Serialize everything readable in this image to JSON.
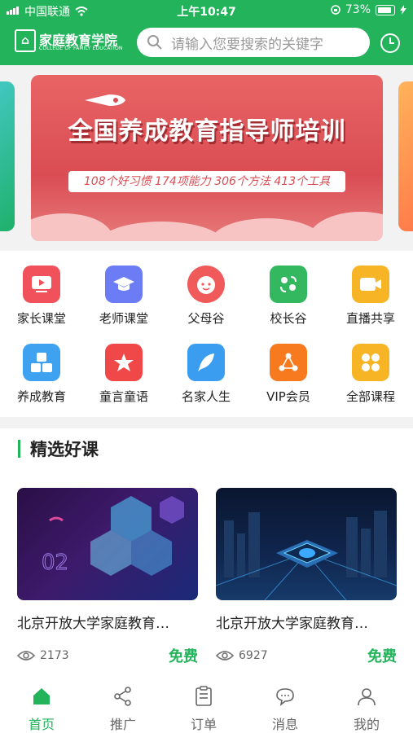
{
  "status_bar": {
    "carrier": "中国联通",
    "time": "上午10:47",
    "battery": "73%"
  },
  "header": {
    "logo_title": "家庭教育学院",
    "logo_subtitle": "COLLEGE OF FAMILY EDUCATION",
    "search_placeholder": "请输入您要搜索的关键字"
  },
  "banner": {
    "title": "全国养成教育指导师培训",
    "subtitle": "108个好习惯 174项能力 306个方法 413个工具"
  },
  "categories": [
    {
      "label": "家长课堂",
      "icon": "video-play-icon",
      "color": "#f0515a"
    },
    {
      "label": "老师课堂",
      "icon": "graduation-cap-icon",
      "color": "#6b7cf4"
    },
    {
      "label": "父母谷",
      "icon": "baby-face-icon",
      "color": "#f05a5a"
    },
    {
      "label": "校长谷",
      "icon": "people-exchange-icon",
      "color": "#33b860"
    },
    {
      "label": "直播共享",
      "icon": "camera-icon",
      "color": "#f7b425"
    },
    {
      "label": "养成教育",
      "icon": "number-blocks-icon",
      "color": "#3ea2f0"
    },
    {
      "label": "童言童语",
      "icon": "star-badge-icon",
      "color": "#f04848"
    },
    {
      "label": "名家人生",
      "icon": "feather-pen-icon",
      "color": "#3a9df0"
    },
    {
      "label": "VIP会员",
      "icon": "vip-network-icon",
      "color": "#f87a1f"
    },
    {
      "label": "全部课程",
      "icon": "grid-icon",
      "color": "#f7b425"
    }
  ],
  "section": {
    "title": "精选好课"
  },
  "courses": [
    {
      "name": "北京开放大学家庭教育…",
      "views": "2173",
      "price": "免费"
    },
    {
      "name": "北京开放大学家庭教育…",
      "views": "6927",
      "price": "免费"
    }
  ],
  "tabbar": [
    {
      "label": "首页",
      "icon": "home-icon",
      "active": true
    },
    {
      "label": "推广",
      "icon": "share-icon",
      "active": false
    },
    {
      "label": "订单",
      "icon": "order-icon",
      "active": false
    },
    {
      "label": "消息",
      "icon": "message-icon",
      "active": false
    },
    {
      "label": "我的",
      "icon": "user-icon",
      "active": false
    }
  ],
  "colors": {
    "brand": "#22b35b",
    "banner": "#d94d53"
  }
}
